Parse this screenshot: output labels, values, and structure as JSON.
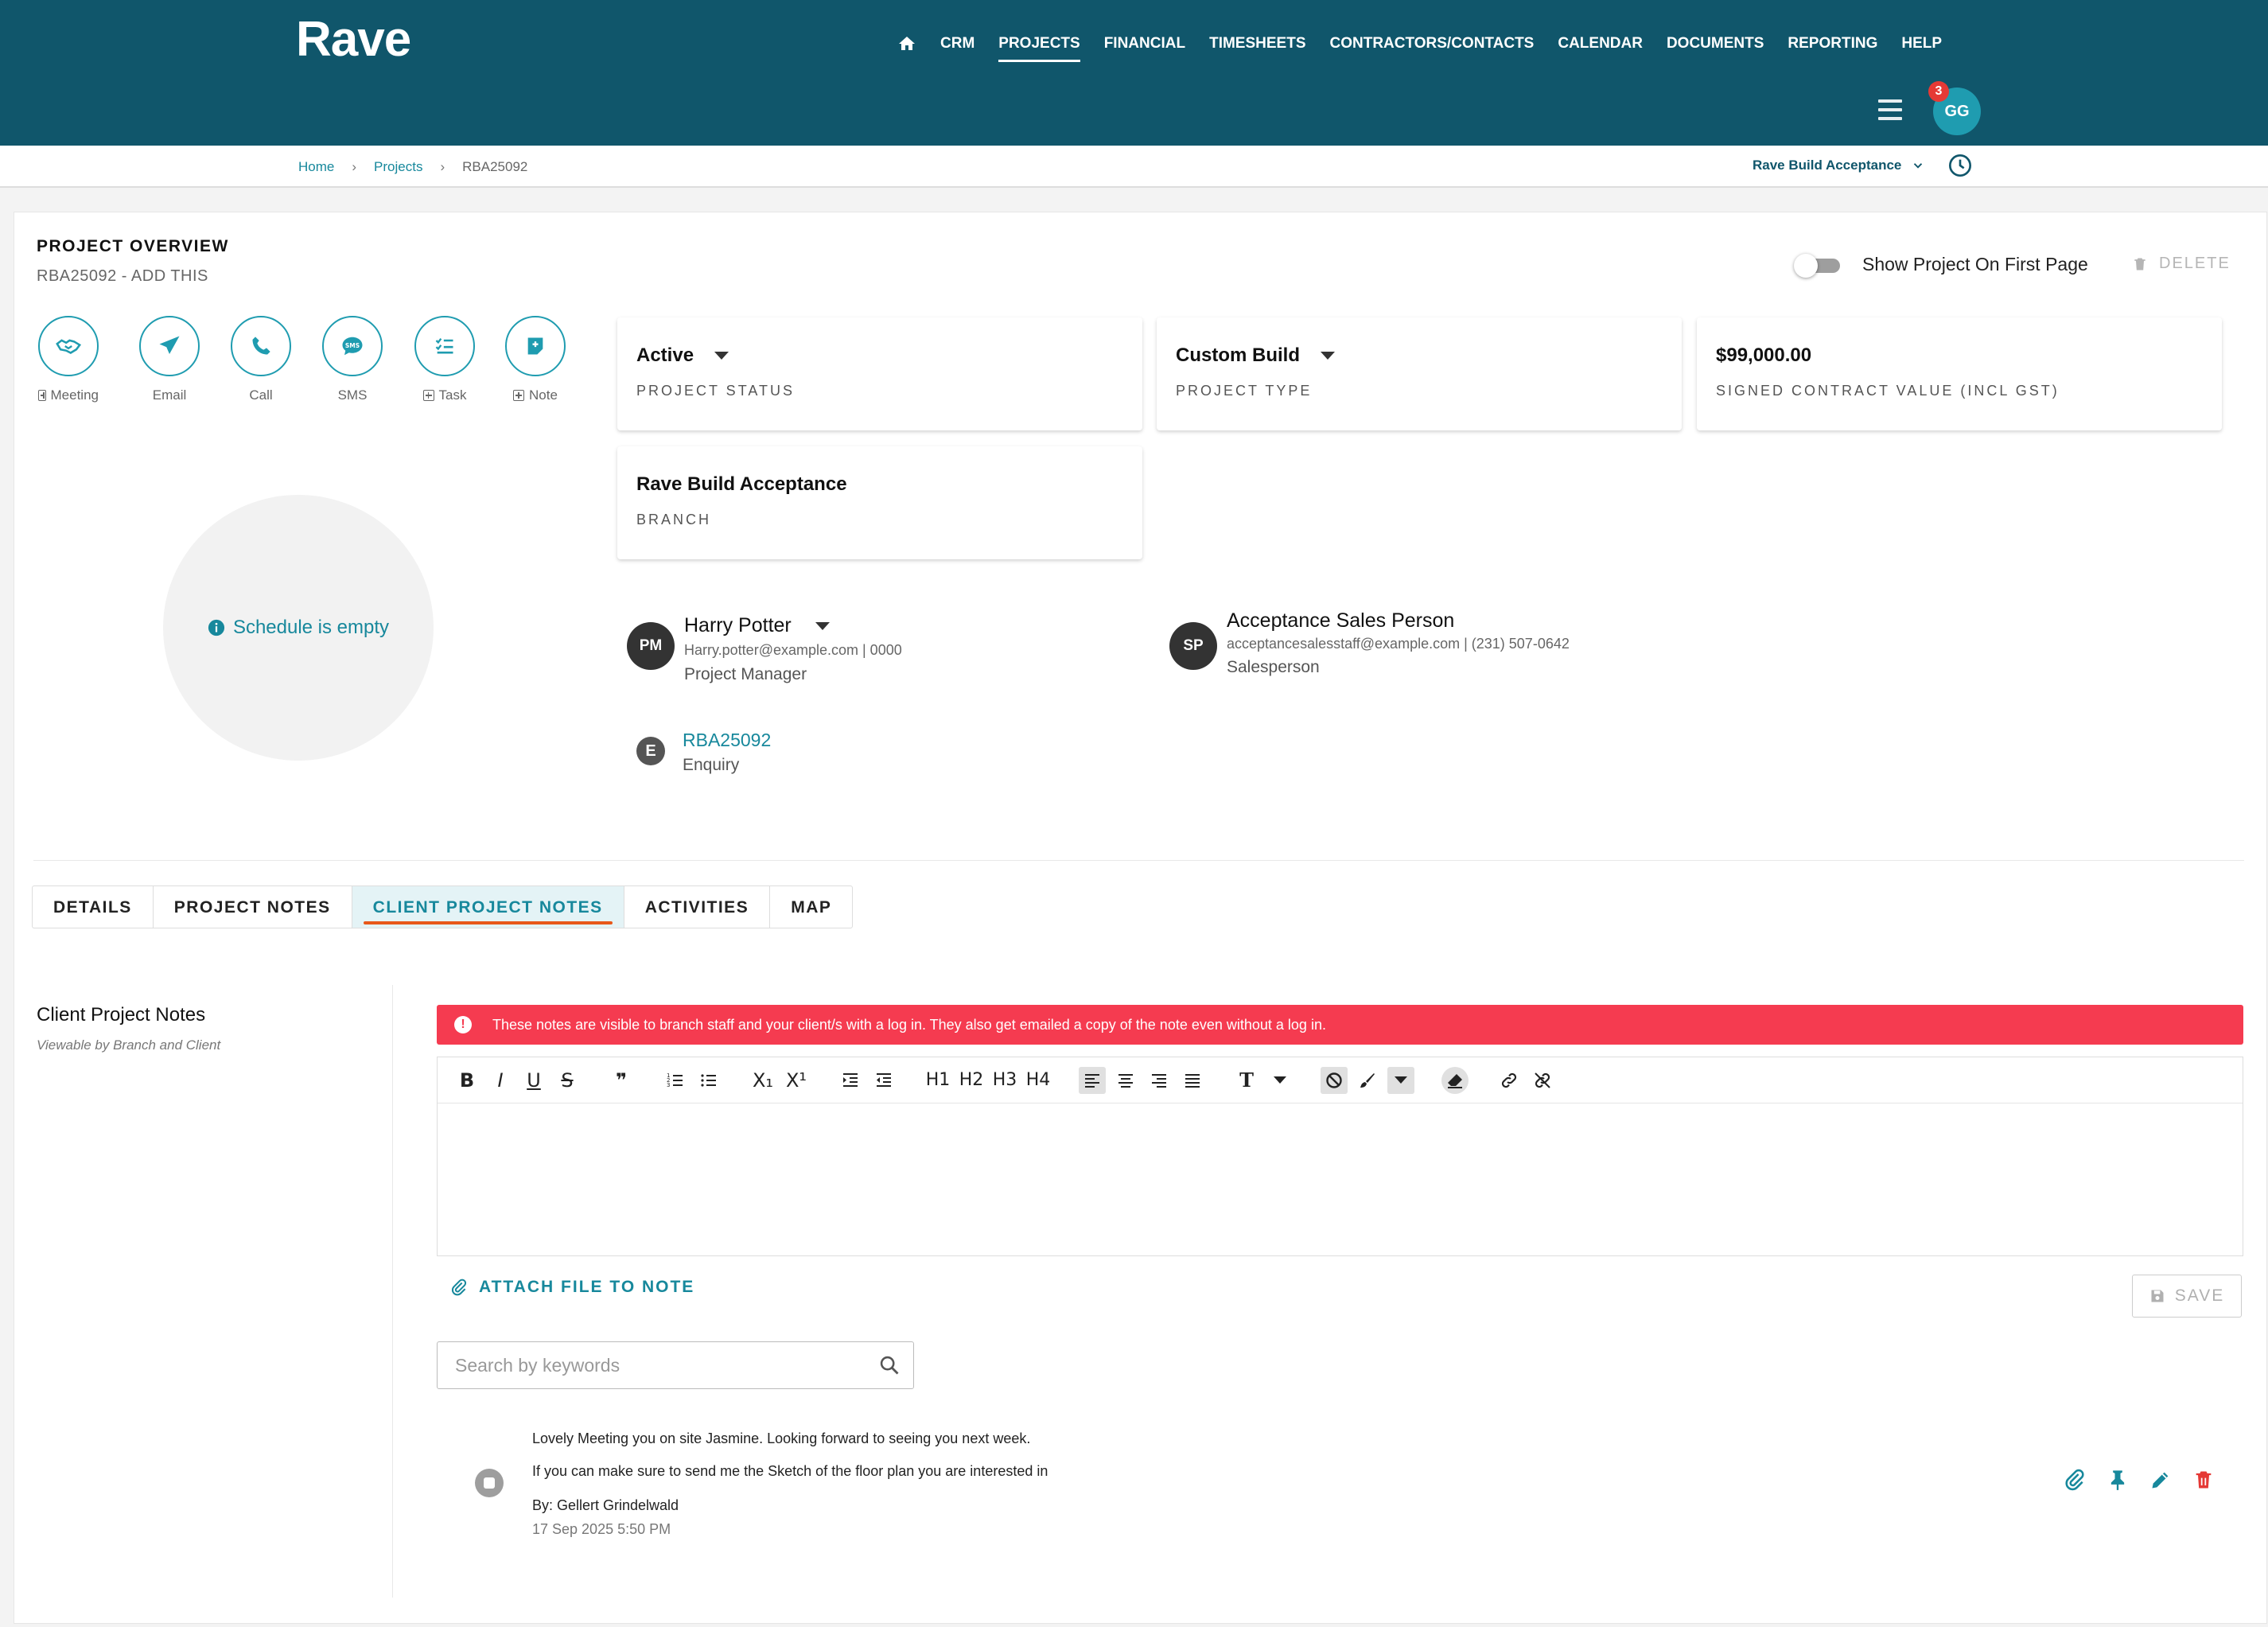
{
  "app": {
    "logo": "Rave"
  },
  "nav": {
    "items": [
      "CRM",
      "PROJECTS",
      "FINANCIAL",
      "TIMESHEETS",
      "CONTRACTORS/CONTACTS",
      "CALENDAR",
      "DOCUMENTS",
      "REPORTING",
      "HELP"
    ],
    "active": "PROJECTS"
  },
  "user": {
    "initials": "GG",
    "notifications": "3"
  },
  "breadcrumb": {
    "home": "Home",
    "projects": "Projects",
    "current": "RBA25092"
  },
  "branch_selector": {
    "label": "Rave Build Acceptance"
  },
  "overview": {
    "title": "PROJECT OVERVIEW",
    "subtitle": "RBA25092 - ADD THIS",
    "show_first_page": "Show Project On First Page",
    "delete": "DELETE",
    "actions": [
      "Meeting",
      "Email",
      "Call",
      "SMS",
      "Task",
      "Note"
    ],
    "schedule_empty": "Schedule is empty"
  },
  "cards": {
    "status": {
      "value": "Active",
      "label": "PROJECT STATUS"
    },
    "type": {
      "value": "Custom Build",
      "label": "PROJECT TYPE"
    },
    "contract": {
      "value": "$99,000.00",
      "label": "SIGNED CONTRACT VALUE (INCL GST)"
    },
    "branch": {
      "value": "Rave Build Acceptance",
      "label": "BRANCH"
    }
  },
  "people": {
    "pm": {
      "initials": "PM",
      "name": "Harry Potter",
      "contact": "Harry.potter@example.com | 0000",
      "role": "Project Manager"
    },
    "sp": {
      "initials": "SP",
      "name": "Acceptance Sales Person",
      "contact": "acceptancesalesstaff@example.com | (231) 507-0642",
      "role": "Salesperson"
    },
    "enquiry": {
      "initials": "E",
      "code": "RBA25092",
      "role": "Enquiry"
    }
  },
  "tabs": [
    "DETAILS",
    "PROJECT NOTES",
    "CLIENT PROJECT NOTES",
    "ACTIVITIES",
    "MAP"
  ],
  "notes_section": {
    "title": "Client Project Notes",
    "subtitle": "Viewable by Branch and Client",
    "alert": "These notes are visible to branch staff and your client/s with a log in. They also get emailed a copy of the note even without a log in.",
    "attach": "ATTACH FILE TO NOTE",
    "save": "SAVE",
    "search_placeholder": "Search by keywords"
  },
  "toolbar": {
    "headings": [
      "H1",
      "H2",
      "H3",
      "H4"
    ],
    "subscript": "X₁",
    "superscript": "X¹",
    "quote": "❞",
    "text_style": "T"
  },
  "note": {
    "line1": "Lovely Meeting you on site Jasmine. Looking forward to seeing you next week.",
    "line2": "If you can make sure to send me the Sketch of the floor plan you are interested in",
    "author": "By: Gellert Grindelwald",
    "date": "17 Sep 2025 5:50 PM"
  },
  "colors": {
    "header": "#10566b",
    "accent": "#1f9cb0",
    "alert": "#f53b50",
    "tab_underline": "#e8581a"
  },
  "icons": [
    "home-icon",
    "menu-icon",
    "clock-icon",
    "meeting-icon",
    "email-icon",
    "call-icon",
    "sms-icon",
    "task-icon",
    "note-icon",
    "info-icon",
    "paperclip-icon",
    "save-icon",
    "search-icon",
    "pin-icon",
    "pencil-icon",
    "trash-icon"
  ]
}
